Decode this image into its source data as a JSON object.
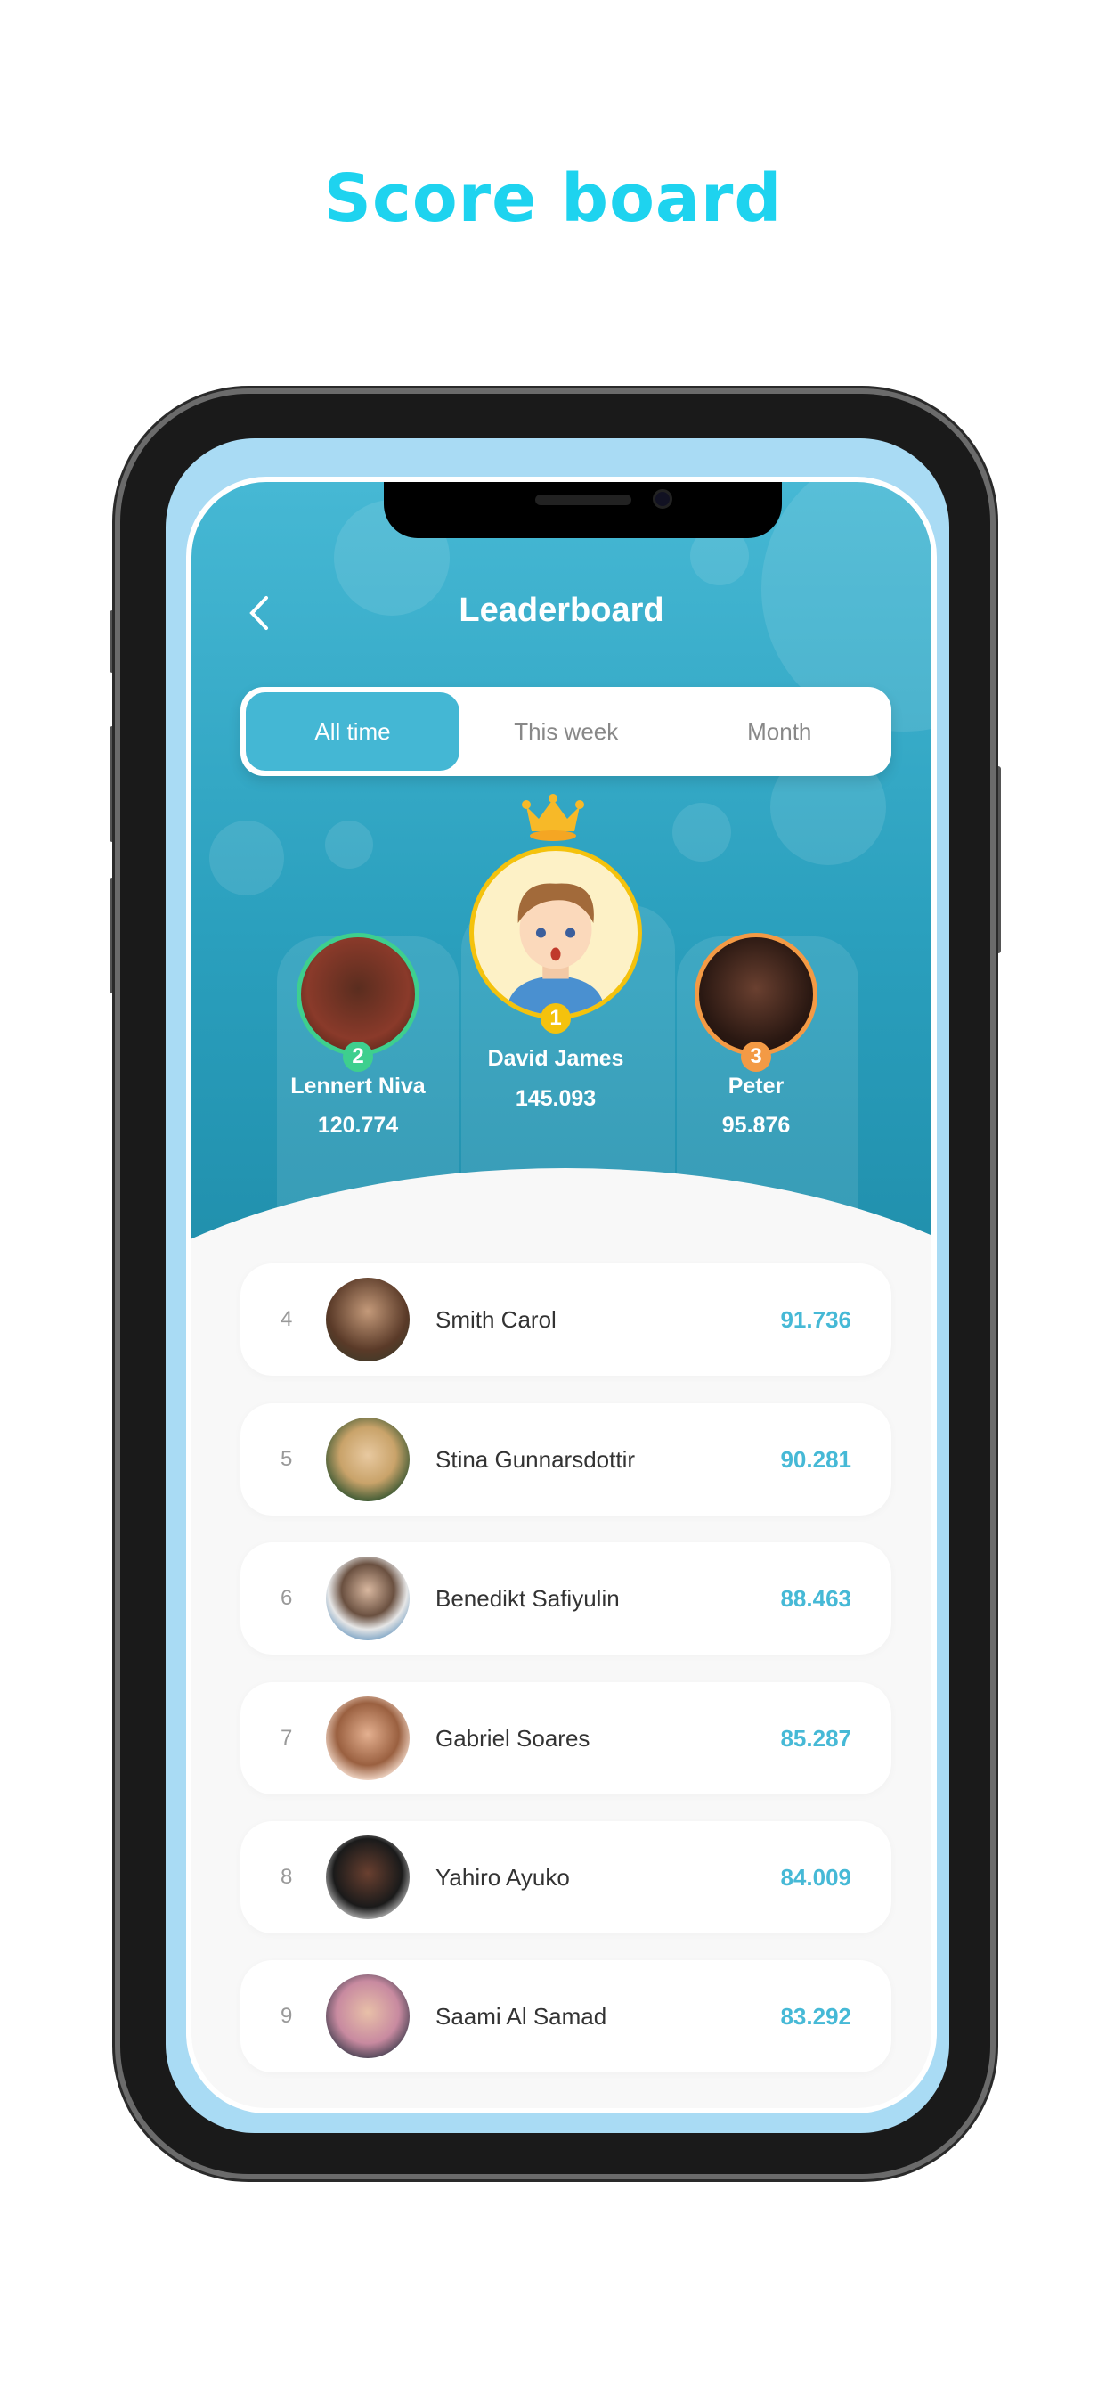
{
  "headline": "Score board",
  "header": {
    "title": "Leaderboard",
    "back_icon": "chevron-left-icon"
  },
  "tabs": [
    {
      "label": "All time",
      "active": true
    },
    {
      "label": "This week",
      "active": false
    },
    {
      "label": "Month",
      "active": false
    }
  ],
  "podium": [
    {
      "rank": "2",
      "name": "Lennert Niva",
      "score": "120.774",
      "ring_color": "#3ecf8e"
    },
    {
      "rank": "1",
      "name": "David James",
      "score": "145.093",
      "ring_color": "#f4c20d"
    },
    {
      "rank": "3",
      "name": "Peter",
      "score": "95.876",
      "ring_color": "#f39a45"
    }
  ],
  "list": [
    {
      "rank": "4",
      "name": "Smith Carol",
      "score": "91.736"
    },
    {
      "rank": "5",
      "name": "Stina Gunnarsdottir",
      "score": "90.281"
    },
    {
      "rank": "6",
      "name": "Benedikt Safiyulin",
      "score": "88.463"
    },
    {
      "rank": "7",
      "name": "Gabriel Soares",
      "score": "85.287"
    },
    {
      "rank": "8",
      "name": "Yahiro Ayuko",
      "score": "84.009"
    },
    {
      "rank": "9",
      "name": "Saami Al Samad",
      "score": "83.292"
    }
  ],
  "colors": {
    "accent": "#46b9d6",
    "headline": "#1ed3ef"
  }
}
